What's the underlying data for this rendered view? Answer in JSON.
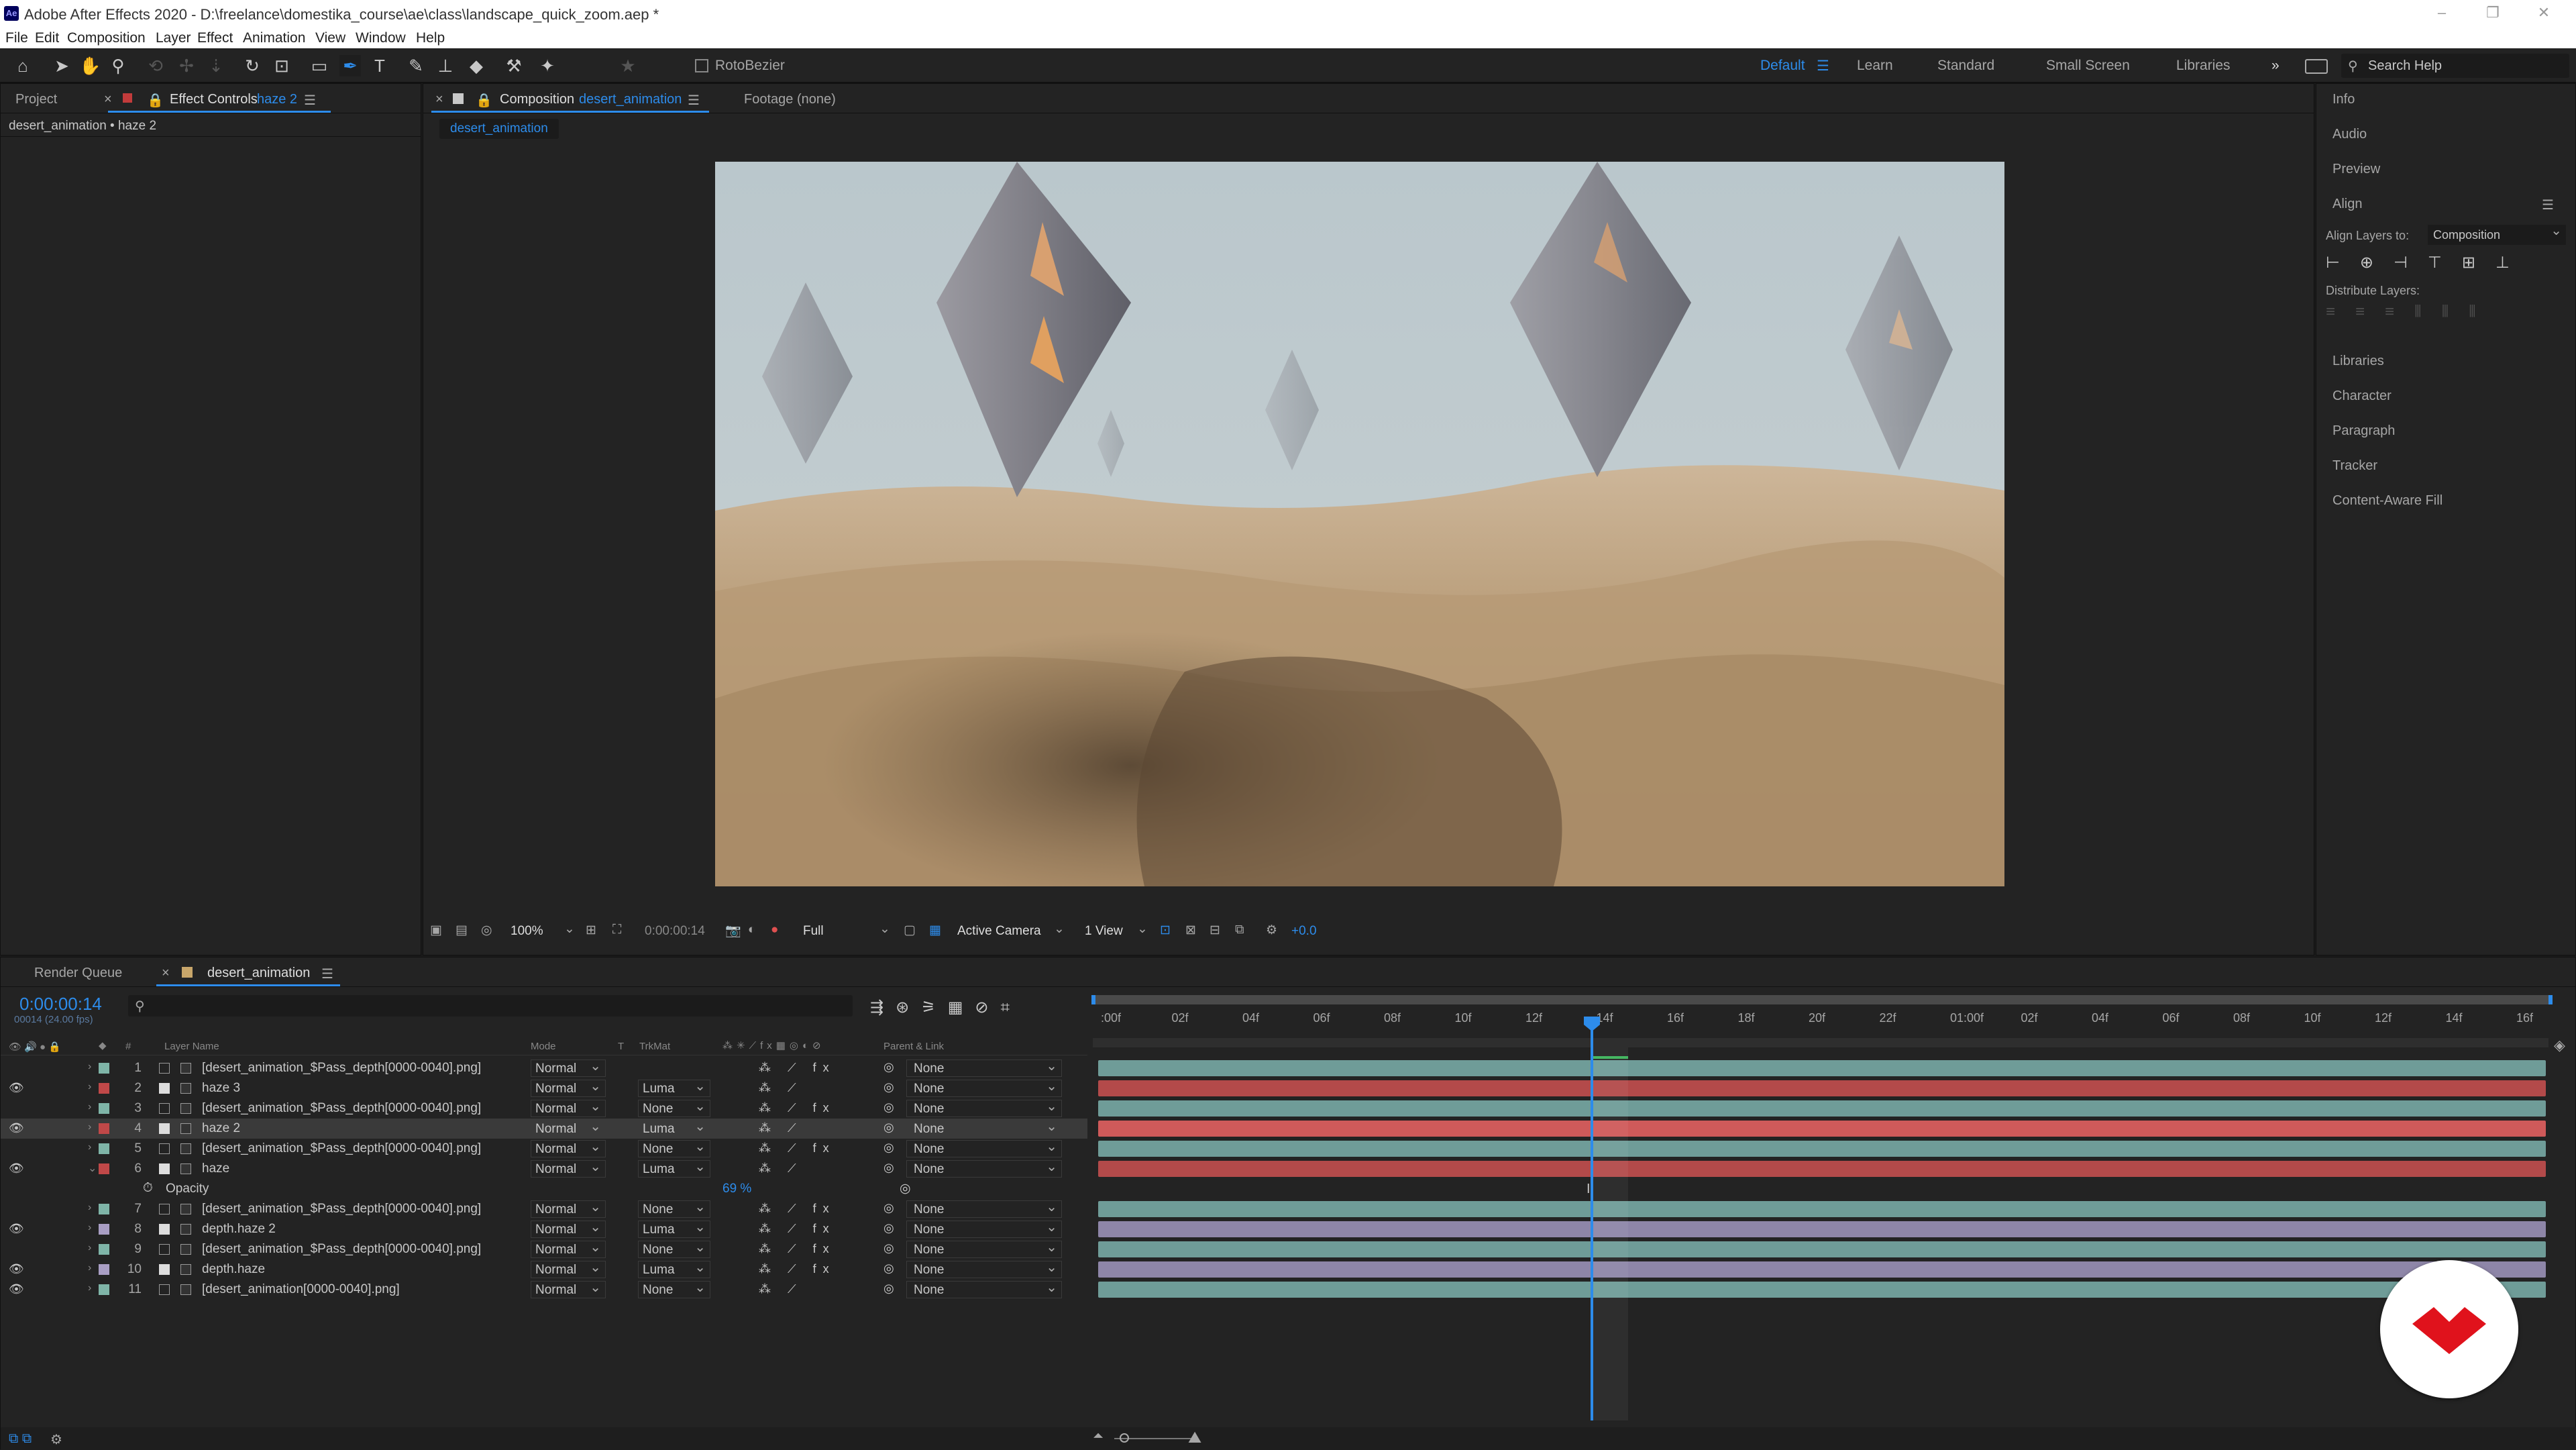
{
  "window": {
    "title": "Adobe After Effects 2020 - D:\\freelance\\domestika_course\\ae\\class\\landscape_quick_zoom.aep *",
    "app_icon": "Ae"
  },
  "menu": [
    "File",
    "Edit",
    "Composition",
    "Layer",
    "Effect",
    "Animation",
    "View",
    "Window",
    "Help"
  ],
  "toolbar": {
    "rotobezier": "RotoBezier",
    "workspaces": [
      "Default",
      "Learn",
      "Standard",
      "Small Screen",
      "Libraries"
    ],
    "active_workspace": "Default",
    "search_placeholder": "Search Help"
  },
  "left_panel": {
    "tabs": [
      "Project",
      "Effect Controls"
    ],
    "effect_controls_layer": "haze 2",
    "breadcrumb": "desert_animation • haze 2"
  },
  "comp_panel": {
    "tab_label": "Composition",
    "comp_name": "desert_animation",
    "footage_tab": "Footage  (none)",
    "sub_tab": "desert_animation",
    "zoom": "100%",
    "timecode": "0:00:00:14",
    "resolution": "Full",
    "camera": "Active Camera",
    "views": "1 View",
    "exposure": "+0.0"
  },
  "right_panel": {
    "items": [
      "Info",
      "Audio",
      "Preview",
      "Align",
      "Libraries",
      "Character",
      "Paragraph",
      "Tracker",
      "Content-Aware Fill"
    ],
    "align_to_label": "Align Layers to:",
    "align_to_value": "Composition",
    "distribute_label": "Distribute Layers:"
  },
  "timeline": {
    "tabs": [
      "Render Queue",
      "desert_animation"
    ],
    "current_time": "0:00:00:14",
    "frame_info": "00014 (24.00 fps)",
    "columns": {
      "num": "#",
      "name": "Layer Name",
      "mode": "Mode",
      "t": "T",
      "trkmat": "TrkMat",
      "parent": "Parent & Link"
    },
    "ruler": [
      ":00f",
      "02f",
      "04f",
      "06f",
      "08f",
      "10f",
      "12f",
      "14f",
      "16f",
      "18f",
      "20f",
      "22f",
      "01:00f",
      "02f",
      "04f",
      "06f",
      "08f",
      "10f",
      "12f",
      "14f",
      "16f"
    ],
    "playhead_frame": 14,
    "layers": [
      {
        "num": "1",
        "name": "[desert_animation_$Pass_depth[0000-0040].png]",
        "mode": "Normal",
        "trkmat": "",
        "parent": "None",
        "color": "#7fb5a8",
        "eye": false,
        "fx": true
      },
      {
        "num": "2",
        "name": "haze 3",
        "mode": "Normal",
        "trkmat": "Luma",
        "parent": "None",
        "color": "#c04848",
        "eye": true,
        "fx": false
      },
      {
        "num": "3",
        "name": "[desert_animation_$Pass_depth[0000-0040].png]",
        "mode": "Normal",
        "trkmat": "None",
        "parent": "None",
        "color": "#7fb5a8",
        "eye": false,
        "fx": true
      },
      {
        "num": "4",
        "name": "haze 2",
        "mode": "Normal",
        "trkmat": "Luma",
        "parent": "None",
        "color": "#c04848",
        "eye": true,
        "fx": false,
        "selected": true
      },
      {
        "num": "5",
        "name": "[desert_animation_$Pass_depth[0000-0040].png]",
        "mode": "Normal",
        "trkmat": "None",
        "parent": "None",
        "color": "#7fb5a8",
        "eye": false,
        "fx": true
      },
      {
        "num": "6",
        "name": "haze",
        "mode": "Normal",
        "trkmat": "Luma",
        "parent": "None",
        "color": "#c04848",
        "eye": true,
        "fx": false,
        "expanded": true
      },
      {
        "num": "7",
        "name": "[desert_animation_$Pass_depth[0000-0040].png]",
        "mode": "Normal",
        "trkmat": "None",
        "parent": "None",
        "color": "#7fb5a8",
        "eye": false,
        "fx": true
      },
      {
        "num": "8",
        "name": "depth.haze 2",
        "mode": "Normal",
        "trkmat": "Luma",
        "parent": "None",
        "color": "#a99ec4",
        "eye": true,
        "fx": true
      },
      {
        "num": "9",
        "name": "[desert_animation_$Pass_depth[0000-0040].png]",
        "mode": "Normal",
        "trkmat": "None",
        "parent": "None",
        "color": "#7fb5a8",
        "eye": false,
        "fx": true
      },
      {
        "num": "10",
        "name": "depth.haze",
        "mode": "Normal",
        "trkmat": "Luma",
        "parent": "None",
        "color": "#a99ec4",
        "eye": true,
        "fx": true
      },
      {
        "num": "11",
        "name": "[desert_animation[0000-0040].png]",
        "mode": "Normal",
        "trkmat": "None",
        "parent": "None",
        "color": "#7fb5a8",
        "eye": true,
        "fx": false
      }
    ],
    "opacity_property": {
      "label": "Opacity",
      "value": "69 %"
    }
  },
  "colors": {
    "accent": "#2d8ceb",
    "bar_aqua": "#6f9c98",
    "bar_red": "#b34a4a",
    "bar_lavender": "#8e86a8"
  }
}
